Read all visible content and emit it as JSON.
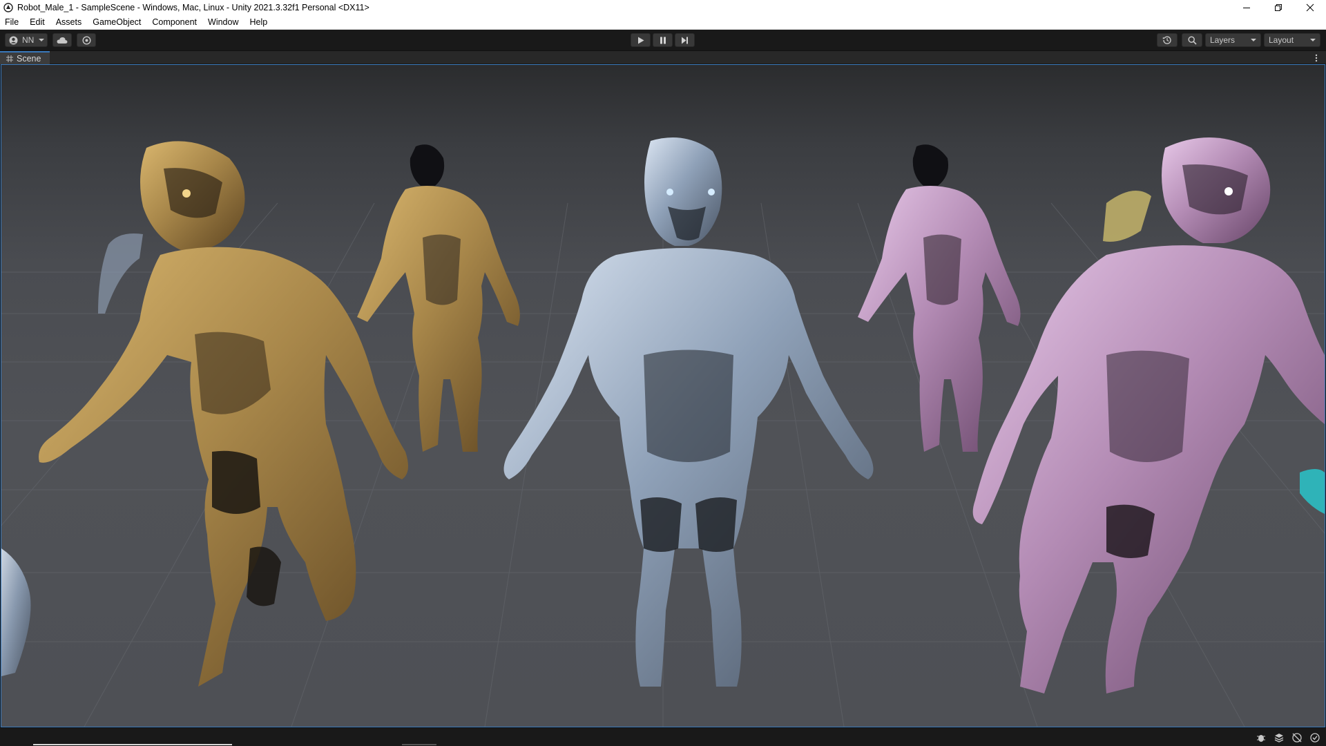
{
  "window": {
    "title": "Robot_Male_1 - SampleScene - Windows, Mac, Linux - Unity 2021.3.32f1 Personal <DX11>"
  },
  "menu": {
    "items": [
      "File",
      "Edit",
      "Assets",
      "GameObject",
      "Component",
      "Window",
      "Help"
    ]
  },
  "toolbar": {
    "account_label": "NN",
    "layers_label": "Layers",
    "layout_label": "Layout",
    "icons": {
      "account": "account-icon",
      "cloud": "cloud-icon",
      "collab": "collab-icon",
      "play": "play-icon",
      "pause": "pause-icon",
      "step": "step-icon",
      "history": "history-icon",
      "search": "search-icon"
    }
  },
  "scene_tab": {
    "label": "Scene"
  },
  "scene": {
    "robots": [
      {
        "name": "robot-gold-front",
        "material": "gold"
      },
      {
        "name": "robot-gold-back",
        "material": "gold"
      },
      {
        "name": "robot-silver-center",
        "material": "silver"
      },
      {
        "name": "robot-purple-back",
        "material": "purple"
      },
      {
        "name": "robot-purple-front",
        "material": "purple"
      }
    ],
    "colors": {
      "gold": "#a8874a",
      "silver": "#8fa1b8",
      "purple": "#b38bb4",
      "accent_blue": "#3a79bb"
    }
  }
}
